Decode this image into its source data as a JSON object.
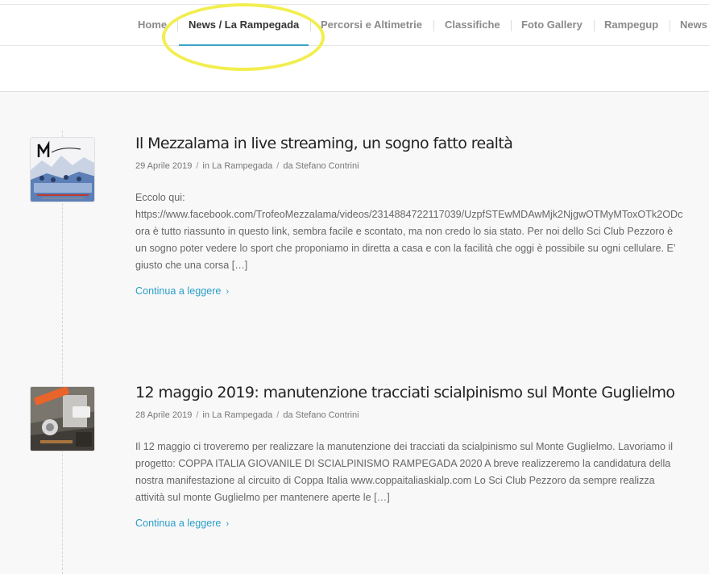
{
  "nav": {
    "items": [
      {
        "label": "Home"
      },
      {
        "label": "News / La Rampegada",
        "active": true
      },
      {
        "label": "Percorsi e Altimetrie"
      },
      {
        "label": "Classifiche"
      },
      {
        "label": "Foto Gallery"
      },
      {
        "label": "Rampegup"
      },
      {
        "label": "News"
      }
    ],
    "accent_color": "#3aa5c6",
    "highlight_color": "#f2ee4f"
  },
  "posts": [
    {
      "title": "Il Mezzalama in live streaming, un sogno fatto realtà",
      "date": "29 Aprile 2019",
      "category_prefix": "in",
      "category": "La Rampegada",
      "author_prefix": "da",
      "author": "Stefano Contrini",
      "excerpt_lines": [
        "Eccolo qui:",
        "https://www.facebook.com/TrofeoMezzalama/videos/2314884722117039/UzpfSTEwMDAwMjk2NjgwOTMyMToxOTk2ODc",
        "ora è tutto riassunto in questo link, sembra facile e scontato, ma non credo lo sia stato. Per noi dello Sci Club Pezzoro è",
        "un sogno poter vedere lo sport che proponiamo in diretta a casa e con la facilità che oggi è possibile su ogni cellulare. E’",
        "giusto che una corsa […]"
      ],
      "read_more": "Continua a leggere",
      "thumb_icon": "mezzalama-poster-image"
    },
    {
      "title": "12 maggio 2019: manutenzione tracciati scialpinismo sul Monte Guglielmo",
      "date": "28 Aprile 2019",
      "category_prefix": "in",
      "category": "La Rampegada",
      "author_prefix": "da",
      "author": "Stefano Contrini",
      "excerpt_lines": [
        "Il 12 maggio ci troveremo per realizzare la manutenzione dei tracciati da scialpinismo sul Monte Guglielmo. Lavoriamo il",
        "progetto: COPPA ITALIA GIOVANILE DI SCIALPINISMO RAMPEGADA 2020 A breve realizzeremo la candidatura della",
        "nostra manifestazione al circuito  di Coppa Italia  www.coppaitaliaskialp.com  Lo Sci Club Pezzoro da sempre realizza",
        "attività sul monte Guglielmo per mantenere aperte le […]"
      ],
      "read_more": "Continua a leggere",
      "thumb_icon": "brushcutter-photo-image"
    }
  ]
}
